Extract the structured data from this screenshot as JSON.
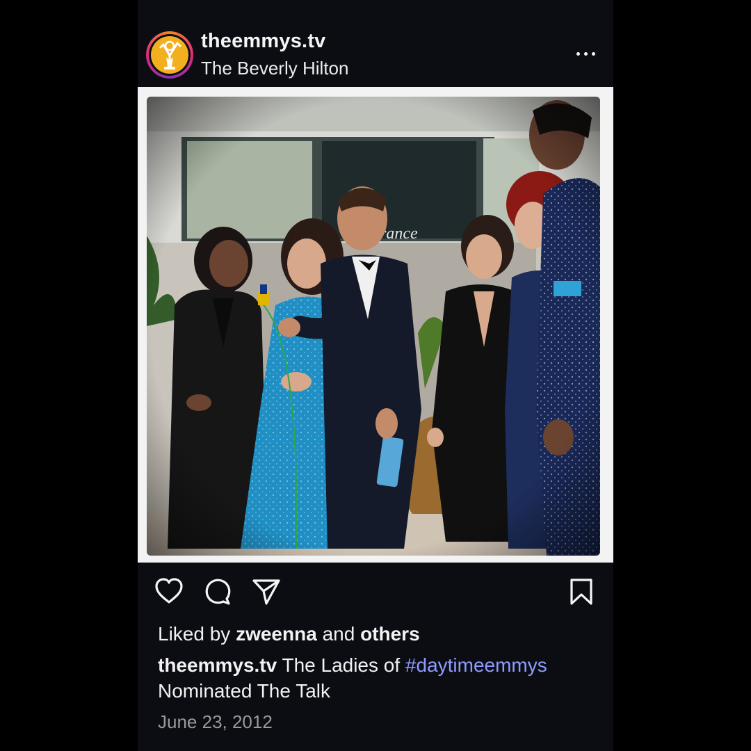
{
  "header": {
    "username": "theemmys.tv",
    "location": "The Beverly Hilton",
    "avatar_icon": "emmy-statuette-icon",
    "more_icon": "more-dots-icon"
  },
  "photo": {
    "sign_text": "rance"
  },
  "actions": {
    "icons": [
      "heart-icon",
      "comment-icon",
      "share-icon",
      "bookmark-icon"
    ]
  },
  "likes": {
    "prefix": "Liked by",
    "user": "zweenna",
    "joiner": "and",
    "others": "others"
  },
  "caption": {
    "username": "theemmys.tv",
    "text_before": "The Ladies of",
    "hashtag": "#daytimeemmys",
    "text_after": "Nominated The Talk"
  },
  "date": "June 23, 2012",
  "colors": {
    "background": "#0c0d13",
    "hashtag": "#8e9bff",
    "avatar_gold": "#f2b01f"
  }
}
